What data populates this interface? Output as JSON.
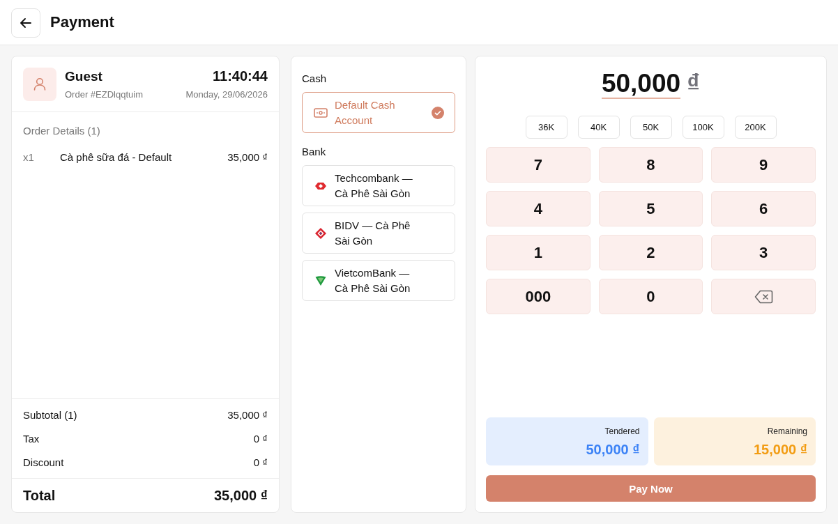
{
  "header": {
    "title": "Payment"
  },
  "order": {
    "customer": "Guest",
    "order_number": "Order #EZDlqqtuim",
    "time": "11:40:44",
    "date": "Monday, 29/06/2026",
    "details_title": "Order Details (1)",
    "items": [
      {
        "quantity": "x1",
        "name": "Cà phê sữa đá - Default",
        "price": "35,000 ₫"
      }
    ],
    "summary": [
      {
        "label": "Subtotal (1)",
        "value": "35,000 ₫"
      },
      {
        "label": "Tax",
        "value": "0 ₫"
      },
      {
        "label": "Discount",
        "value": "0 ₫"
      }
    ],
    "total": {
      "label": "Total",
      "value": "35,000 ₫"
    }
  },
  "payment_methods": {
    "sections": [
      {
        "label": "Cash",
        "accounts": [
          {
            "name": "Default Cash Account",
            "kind": "cash",
            "selected": true
          }
        ]
      },
      {
        "label": "Bank",
        "accounts": [
          {
            "name": "Techcombank — Cà Phê Sài Gòn",
            "kind": "bank",
            "selected": false
          },
          {
            "name": "BIDV — Cà Phê Sài Gòn",
            "kind": "bank",
            "selected": false
          },
          {
            "name": "VietcomBank — Cà Phê Sài Gòn",
            "kind": "bank",
            "selected": false
          }
        ]
      }
    ]
  },
  "amount": {
    "value": "50,000",
    "currency": "₫"
  },
  "quick_amounts": [
    "36K",
    "40K",
    "50K",
    "100K",
    "200K"
  ],
  "keypad": [
    {
      "kind": "digit",
      "label": "7"
    },
    {
      "kind": "digit",
      "label": "8"
    },
    {
      "kind": "digit",
      "label": "9"
    },
    {
      "kind": "digit",
      "label": "4"
    },
    {
      "kind": "digit",
      "label": "5"
    },
    {
      "kind": "digit",
      "label": "6"
    },
    {
      "kind": "digit",
      "label": "1"
    },
    {
      "kind": "digit",
      "label": "2"
    },
    {
      "kind": "digit",
      "label": "3"
    },
    {
      "kind": "digit",
      "label": "000"
    },
    {
      "kind": "digit",
      "label": "0"
    },
    {
      "kind": "backspace"
    }
  ],
  "balances": [
    {
      "label": "Tendered",
      "value": "50,000 ₫",
      "color": "#3b82f6"
    },
    {
      "label": "Remaining",
      "value": "15,000 ₫",
      "color": "#f29c12"
    }
  ],
  "pay_button": {
    "label": "Pay Now"
  }
}
